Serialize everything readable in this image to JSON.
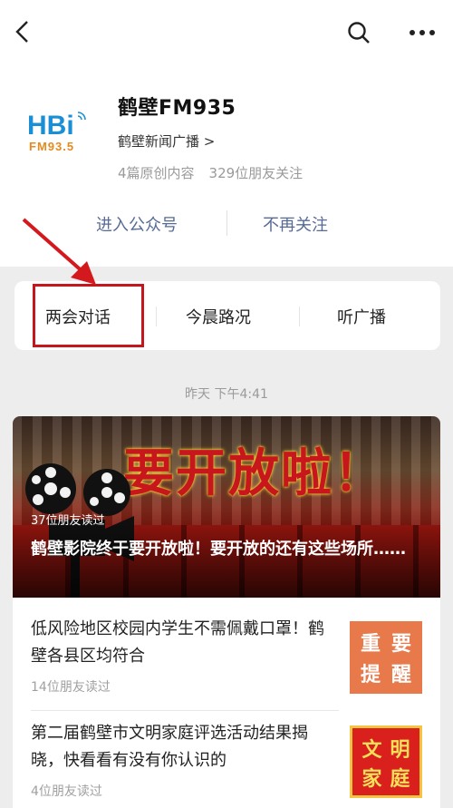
{
  "profile": {
    "name": "鹤壁FM935",
    "subtitle": "鹤壁新闻广播 >",
    "original_count": "4篇原创内容",
    "followers": "329位朋友关注",
    "logo_text": "HBi",
    "logo_freq": "FM93.5"
  },
  "actions": {
    "enter": "进入公众号",
    "unfollow": "不再关注"
  },
  "menu": [
    {
      "label": "两会对话"
    },
    {
      "label": "今晨路况"
    },
    {
      "label": "听广播"
    }
  ],
  "timestamp": "昨天 下午4:41",
  "cover": {
    "title_text": "要开放啦！",
    "reads": "37位朋友读过",
    "caption": "鹤壁影院终于要开放啦！要开放的还有这些场所……"
  },
  "articles": [
    {
      "title": "低风险地区校园内学生不需佩戴口罩！鹤壁各县区均符合",
      "reads": "14位朋友读过",
      "thumb": [
        "重",
        "要",
        "提",
        "醒"
      ]
    },
    {
      "title": "第二届鹤壁市文明家庭评选活动结果揭晓，快看看有没有你认识的",
      "reads": "4位朋友读过",
      "thumb": [
        "文",
        "明",
        "家",
        "庭"
      ]
    }
  ],
  "icons": {
    "back": "back-chevron-icon",
    "search": "search-icon",
    "more": "more-dots-icon"
  },
  "colors": {
    "link": "#576b95",
    "highlight": "#c4161c",
    "background": "#ededed"
  }
}
